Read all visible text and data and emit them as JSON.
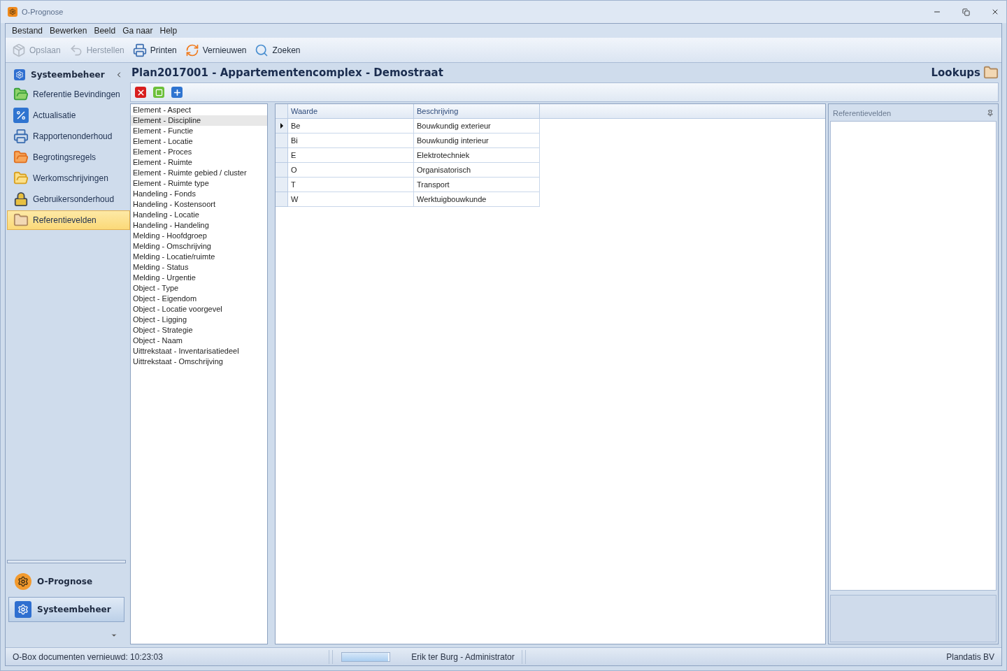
{
  "window": {
    "title": "O-Prognose"
  },
  "menu": [
    "Bestand",
    "Bewerken",
    "Beeld",
    "Ga naar",
    "Help"
  ],
  "toolbar": [
    {
      "label": "Opslaan",
      "kind": "save",
      "disabled": true
    },
    {
      "label": "Herstellen",
      "kind": "undo",
      "disabled": true
    },
    {
      "label": "Printen",
      "kind": "print",
      "disabled": false
    },
    {
      "label": "Vernieuwen",
      "kind": "refresh",
      "disabled": false
    },
    {
      "label": "Zoeken",
      "kind": "search",
      "disabled": false
    }
  ],
  "sidebar": {
    "title": "Systeembeheer",
    "items": [
      {
        "label": "Referentie Bevindingen",
        "kind": "folder-green",
        "selected": false
      },
      {
        "label": "Actualisatie",
        "kind": "percent",
        "selected": false
      },
      {
        "label": "Rapportenonderhoud",
        "kind": "printer",
        "selected": false
      },
      {
        "label": "Begrotingsregels",
        "kind": "folder-orange",
        "selected": false
      },
      {
        "label": "Werkomschrijvingen",
        "kind": "folder-yellow",
        "selected": false
      },
      {
        "label": "Gebruikersonderhoud",
        "kind": "lock",
        "selected": false
      },
      {
        "label": "Referentievelden",
        "kind": "folder-search",
        "selected": true
      }
    ],
    "modules": [
      {
        "label": "O-Prognose",
        "kind": "prognose",
        "selected": false
      },
      {
        "label": "Systeembeheer",
        "kind": "gear",
        "selected": true
      }
    ]
  },
  "header": {
    "title": "Plan2017001 - Appartementencomplex - Demostraat",
    "section": "Lookups"
  },
  "lookup_list": [
    {
      "label": "Element - Aspect",
      "selected": false
    },
    {
      "label": "Element - Discipline",
      "selected": true
    },
    {
      "label": "Element - Functie",
      "selected": false
    },
    {
      "label": "Element - Locatie",
      "selected": false
    },
    {
      "label": "Element - Proces",
      "selected": false
    },
    {
      "label": "Element - Ruimte",
      "selected": false
    },
    {
      "label": "Element - Ruimte gebied / cluster",
      "selected": false
    },
    {
      "label": "Element - Ruimte type",
      "selected": false
    },
    {
      "label": "Handeling - Fonds",
      "selected": false
    },
    {
      "label": "Handeling - Kostensoort",
      "selected": false
    },
    {
      "label": "Handeling - Locatie",
      "selected": false
    },
    {
      "label": "Handeling - Handeling",
      "selected": false
    },
    {
      "label": "Melding - Hoofdgroep",
      "selected": false
    },
    {
      "label": "Melding - Omschrijving",
      "selected": false
    },
    {
      "label": "Melding - Locatie/ruimte",
      "selected": false
    },
    {
      "label": "Melding - Status",
      "selected": false
    },
    {
      "label": "Melding - Urgentie",
      "selected": false
    },
    {
      "label": "Object - Type",
      "selected": false
    },
    {
      "label": "Object - Eigendom",
      "selected": false
    },
    {
      "label": "Object - Locatie voorgevel",
      "selected": false
    },
    {
      "label": "Object - Ligging",
      "selected": false
    },
    {
      "label": "Object - Strategie",
      "selected": false
    },
    {
      "label": "Object - Naam",
      "selected": false
    },
    {
      "label": "Uittrekstaat - Inventarisatiedeel",
      "selected": false
    },
    {
      "label": "Uittrekstaat - Omschrijving",
      "selected": false
    }
  ],
  "table": {
    "columns": [
      "Waarde",
      "Beschrijving"
    ],
    "rows": [
      {
        "cells": [
          "Be",
          "Bouwkundig exterieur"
        ],
        "selected": true
      },
      {
        "cells": [
          "Bi",
          "Bouwkundig interieur"
        ],
        "selected": false
      },
      {
        "cells": [
          "E",
          "Elektrotechniek"
        ],
        "selected": false
      },
      {
        "cells": [
          "O",
          "Organisatorisch"
        ],
        "selected": false
      },
      {
        "cells": [
          "T",
          "Transport"
        ],
        "selected": false
      },
      {
        "cells": [
          "W",
          "Werktuigbouwkunde"
        ],
        "selected": false
      }
    ]
  },
  "side_panel": {
    "title": "Referentievelden"
  },
  "status_bar": {
    "message": "O-Box documenten vernieuwd: 10:23:03",
    "progress": {
      "level": 0.97
    },
    "user": "Erik ter Burg - Administrator",
    "company": "Plandatis BV"
  }
}
